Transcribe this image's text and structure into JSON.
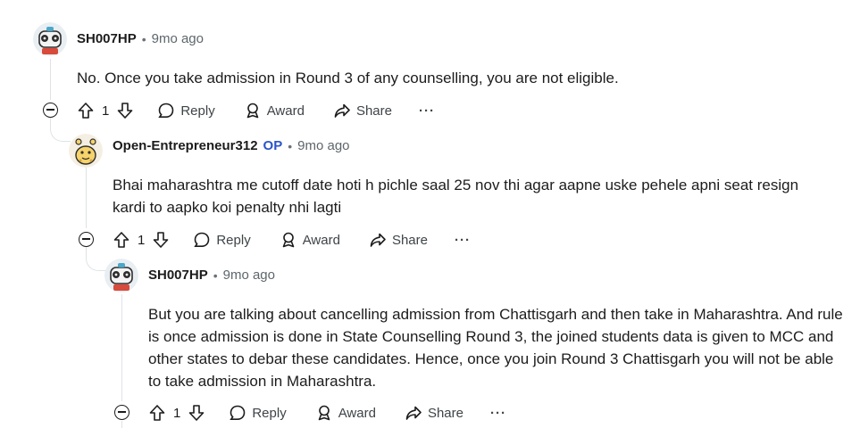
{
  "comments": [
    {
      "author": "SH007HP",
      "op_badge": "",
      "time": "9mo ago",
      "body": "No. Once you take admission in Round 3 of any counselling, you are not eligible.",
      "votes": "1",
      "reply_label": "Reply",
      "award_label": "Award",
      "share_label": "Share",
      "more_label": "···"
    },
    {
      "author": "Open-Entrepreneur312",
      "op_badge": "OP",
      "time": "9mo ago",
      "body": "Bhai maharashtra me cutoff date hoti h pichle saal 25 nov thi agar aapne uske pehele apni seat resign kardi to aapko koi penalty nhi lagti",
      "votes": "1",
      "reply_label": "Reply",
      "award_label": "Award",
      "share_label": "Share",
      "more_label": "···"
    },
    {
      "author": "SH007HP",
      "op_badge": "",
      "time": "9mo ago",
      "body": "But you are talking about cancelling admission from Chattisgarh and then take in Maharashtra. And rule is once admission is done in State Counselling Round 3, the joined students data is given to MCC and other states to debar these candidates. Hence, once you join Round 3 Chattisgarh you will not be able to take admission in Maharashtra.",
      "votes": "1",
      "reply_label": "Reply",
      "award_label": "Award",
      "share_label": "Share",
      "more_label": "···"
    }
  ],
  "separator": "•",
  "colors": {
    "op_badge": "#2a55c9",
    "thread_line": "#dfe3e6",
    "meta_text": "#5e666b"
  }
}
